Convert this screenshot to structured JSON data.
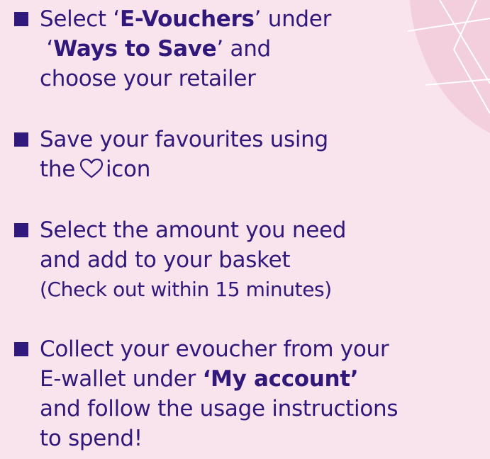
{
  "steps": [
    {
      "lines": [
        {
          "a": "Select ‘",
          "b": "E-Vouchers",
          "c": "’ under"
        },
        {
          "a": " ‘",
          "b": "Ways to Save",
          "c": "’ and"
        },
        {
          "a": "choose your retailer"
        }
      ]
    },
    {
      "lines": [
        {
          "a": "Save your favourites using"
        },
        {
          "a": "the",
          "icon": "heart-icon",
          "c": "icon"
        }
      ]
    },
    {
      "lines": [
        {
          "a": "Select the amount you need"
        },
        {
          "a": "and add to your basket"
        }
      ],
      "note": "(Check out within 15 minutes)"
    },
    {
      "lines": [
        {
          "a": "Collect your evoucher from your"
        },
        {
          "a": "E-wallet under ",
          "b": "‘My account’"
        },
        {
          "a": "and follow the usage instructions"
        },
        {
          "a": "to spend!"
        }
      ]
    }
  ],
  "colors": {
    "background": "#f9e3ec",
    "text": "#31197b",
    "bullet": "#31197b",
    "decoration": "#f3cedd"
  }
}
